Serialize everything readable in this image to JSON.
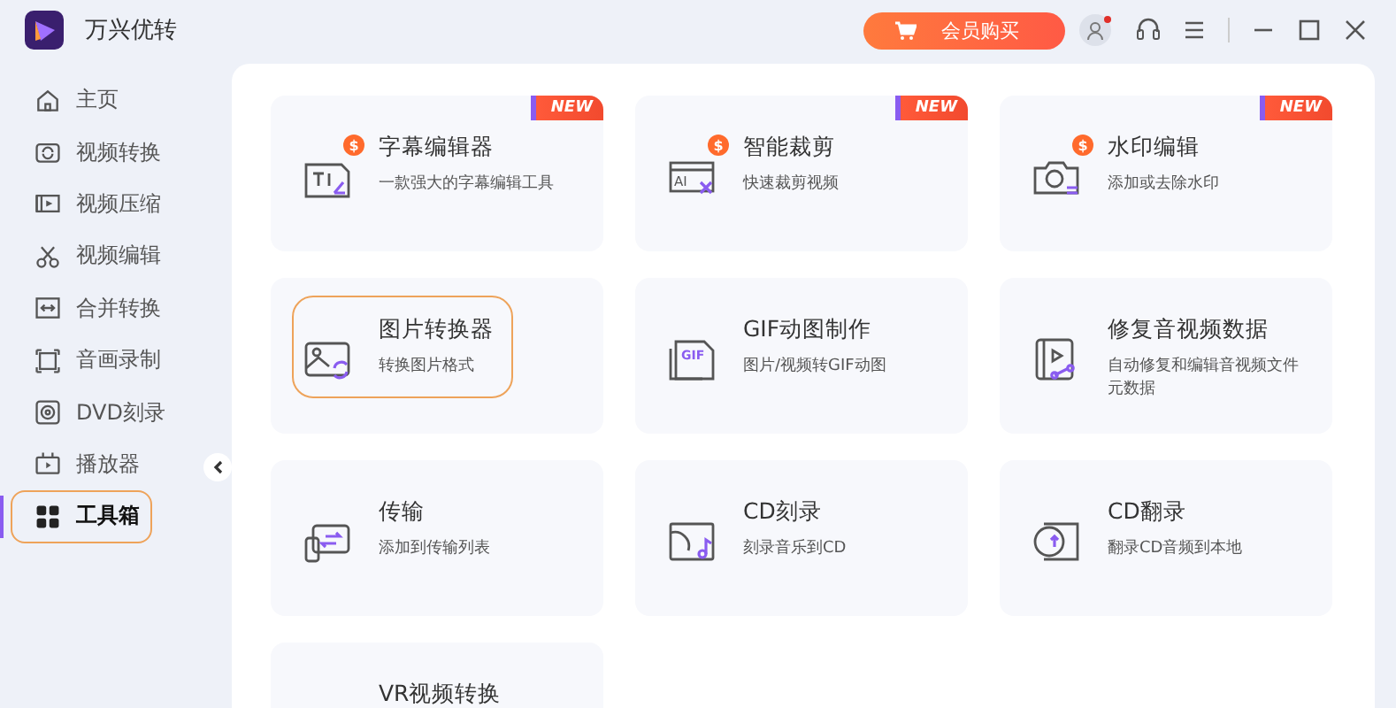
{
  "app": {
    "title": "万兴优转"
  },
  "header": {
    "buy_button": "会员购买",
    "account_notification": true
  },
  "sidebar": {
    "items": [
      {
        "label": "主页",
        "selected": false
      },
      {
        "label": "视频转换",
        "selected": false
      },
      {
        "label": "视频压缩",
        "selected": false
      },
      {
        "label": "视频编辑",
        "selected": false
      },
      {
        "label": "合并转换",
        "selected": false
      },
      {
        "label": "音画录制",
        "selected": false
      },
      {
        "label": "DVD刻录",
        "selected": false
      },
      {
        "label": "播放器",
        "selected": false
      },
      {
        "label": "工具箱",
        "selected": true
      }
    ]
  },
  "tools": [
    {
      "title": "字幕编辑器",
      "description": "一款强大的字幕编辑工具",
      "badge": "NEW",
      "coin": "$",
      "highlighted": false
    },
    {
      "title": "智能裁剪",
      "description": "快速裁剪视频",
      "badge": "NEW",
      "coin": "$",
      "icon_text": "AI",
      "highlighted": false
    },
    {
      "title": "水印编辑",
      "description": "添加或去除水印",
      "badge": "NEW",
      "coin": "$",
      "highlighted": false
    },
    {
      "title": "图片转换器",
      "description": "转换图片格式",
      "highlighted": true
    },
    {
      "title": "GIF动图制作",
      "description": "图片/视频转GIF动图",
      "icon_text": "GIF",
      "highlighted": false
    },
    {
      "title": "修复音视频数据",
      "description": "自动修复和编辑音视频文件元数据",
      "highlighted": false
    },
    {
      "title": "传输",
      "description": "添加到传输列表",
      "highlighted": false
    },
    {
      "title": "CD刻录",
      "description": "刻录音乐到CD",
      "highlighted": false
    },
    {
      "title": "CD翻录",
      "description": "翻录CD音频到本地",
      "highlighted": false
    },
    {
      "title": "VR视频转换",
      "highlighted": false
    }
  ]
}
